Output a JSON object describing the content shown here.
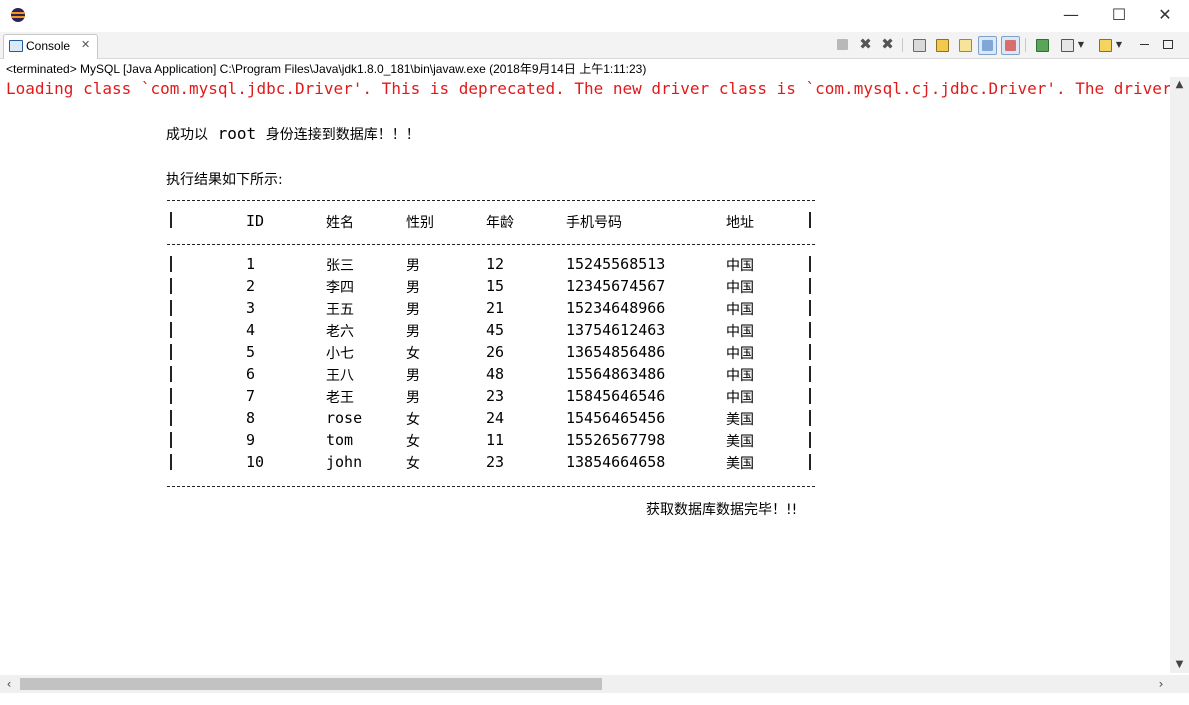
{
  "window": {
    "minimize": "—",
    "maximize": "☐",
    "close": "✕"
  },
  "tab": {
    "label": "Console",
    "close": "✕"
  },
  "toolbar": {
    "icons": [
      "terminate-icon",
      "remove-launch-icon",
      "remove-all-terminated-icon",
      "clear-console-icon",
      "scroll-lock-icon",
      "word-wrap-icon",
      "show-on-stdout-icon",
      "show-on-stderr-icon",
      "pin-console-icon",
      "display-selected-console-icon",
      "open-console-icon",
      "minimize-view-icon",
      "maximize-view-icon"
    ]
  },
  "status_line": "<terminated> MySQL [Java Application] C:\\Program Files\\Java\\jdk1.8.0_181\\bin\\javaw.exe (2018年9月14日 上午1:11:23)",
  "console": {
    "error_line": "Loading class `com.mysql.jdbc.Driver'. This is deprecated. The new driver class is `com.mysql.cj.jdbc.Driver'. The driver is automatically registered",
    "connected_prefix": "成功以",
    "connected_user": " root ",
    "connected_suffix": "身份连接到数据库！！！",
    "result_heading": "执行结果如下所示:",
    "separator": "--------------------------------------------------------------------------------",
    "pipe": "|",
    "headers": {
      "id": "ID",
      "name": "姓名",
      "gender": "性别",
      "age": "年龄",
      "phone": "手机号码",
      "address": "地址"
    },
    "rows": [
      {
        "id": "1",
        "name": "张三",
        "gender": "男",
        "age": "12",
        "phone": "15245568513",
        "address": "中国"
      },
      {
        "id": "2",
        "name": "李四",
        "gender": "男",
        "age": "15",
        "phone": "12345674567",
        "address": "中国"
      },
      {
        "id": "3",
        "name": "王五",
        "gender": "男",
        "age": "21",
        "phone": "15234648966",
        "address": "中国"
      },
      {
        "id": "4",
        "name": "老六",
        "gender": "男",
        "age": "45",
        "phone": "13754612463",
        "address": "中国"
      },
      {
        "id": "5",
        "name": "小七",
        "gender": "女",
        "age": "26",
        "phone": "13654856486",
        "address": "中国"
      },
      {
        "id": "6",
        "name": "王八",
        "gender": "男",
        "age": "48",
        "phone": "15564863486",
        "address": "中国"
      },
      {
        "id": "7",
        "name": "老王",
        "gender": "男",
        "age": "23",
        "phone": "15845646546",
        "address": "中国"
      },
      {
        "id": "8",
        "name": "rose",
        "gender": "女",
        "age": "24",
        "phone": "15456465456",
        "address": "美国"
      },
      {
        "id": "9",
        "name": "tom",
        "gender": "女",
        "age": "11",
        "phone": "15526567798",
        "address": "美国"
      },
      {
        "id": "10",
        "name": "john",
        "gender": "女",
        "age": "23",
        "phone": "13854664658",
        "address": "美国"
      }
    ],
    "done_line": "获取数据库数据完毕！!!"
  },
  "scrollbars": {
    "up": "▲",
    "down": "▼",
    "left": "‹",
    "right": "›"
  },
  "colors": {
    "error": "#e01a1a",
    "eclipse_purple": "#2c2255",
    "eclipse_orange": "#f7941e"
  }
}
